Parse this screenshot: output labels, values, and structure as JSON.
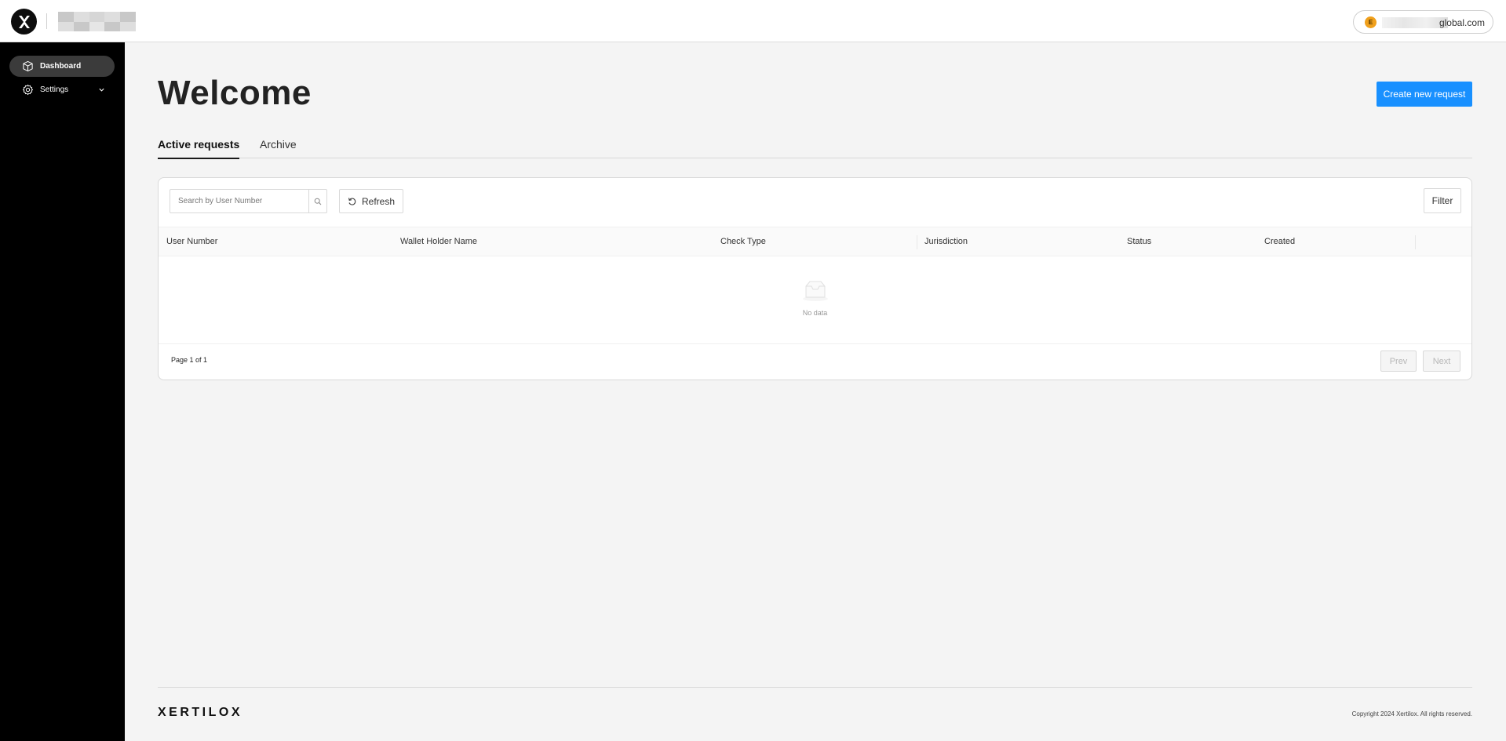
{
  "header": {
    "logo_icon": "x-logo-icon",
    "user_initial": "E",
    "user_email_visible": "global.com"
  },
  "sidebar": {
    "items": [
      {
        "label": "Dashboard",
        "icon": "cube-icon",
        "active": true
      },
      {
        "label": "Settings",
        "icon": "gear-icon",
        "expandable": true
      }
    ]
  },
  "main": {
    "title": "Welcome",
    "create_button": "Create new request",
    "tabs": [
      {
        "label": "Active requests",
        "active": true
      },
      {
        "label": "Archive",
        "active": false
      }
    ]
  },
  "toolbar": {
    "search_placeholder": "Search by User Number",
    "refresh_label": "Refresh",
    "filter_label": "Filter"
  },
  "table": {
    "columns": [
      "User Number",
      "Wallet Holder Name",
      "Check Type",
      "Jurisdiction",
      "Status",
      "Created"
    ],
    "rows": [],
    "empty_text": "No data"
  },
  "pagination": {
    "text": "Page 1 of 1",
    "prev_label": "Prev",
    "next_label": "Next"
  },
  "footer": {
    "logo_text": "XERTILOX",
    "copyright": "Copyright 2024 Xertilox. All rights reserved."
  },
  "colors": {
    "accent": "#1890ff",
    "sidebar_bg": "#000000",
    "active_nav_bg": "#3b3b3b",
    "avatar": "#f0a01c"
  }
}
